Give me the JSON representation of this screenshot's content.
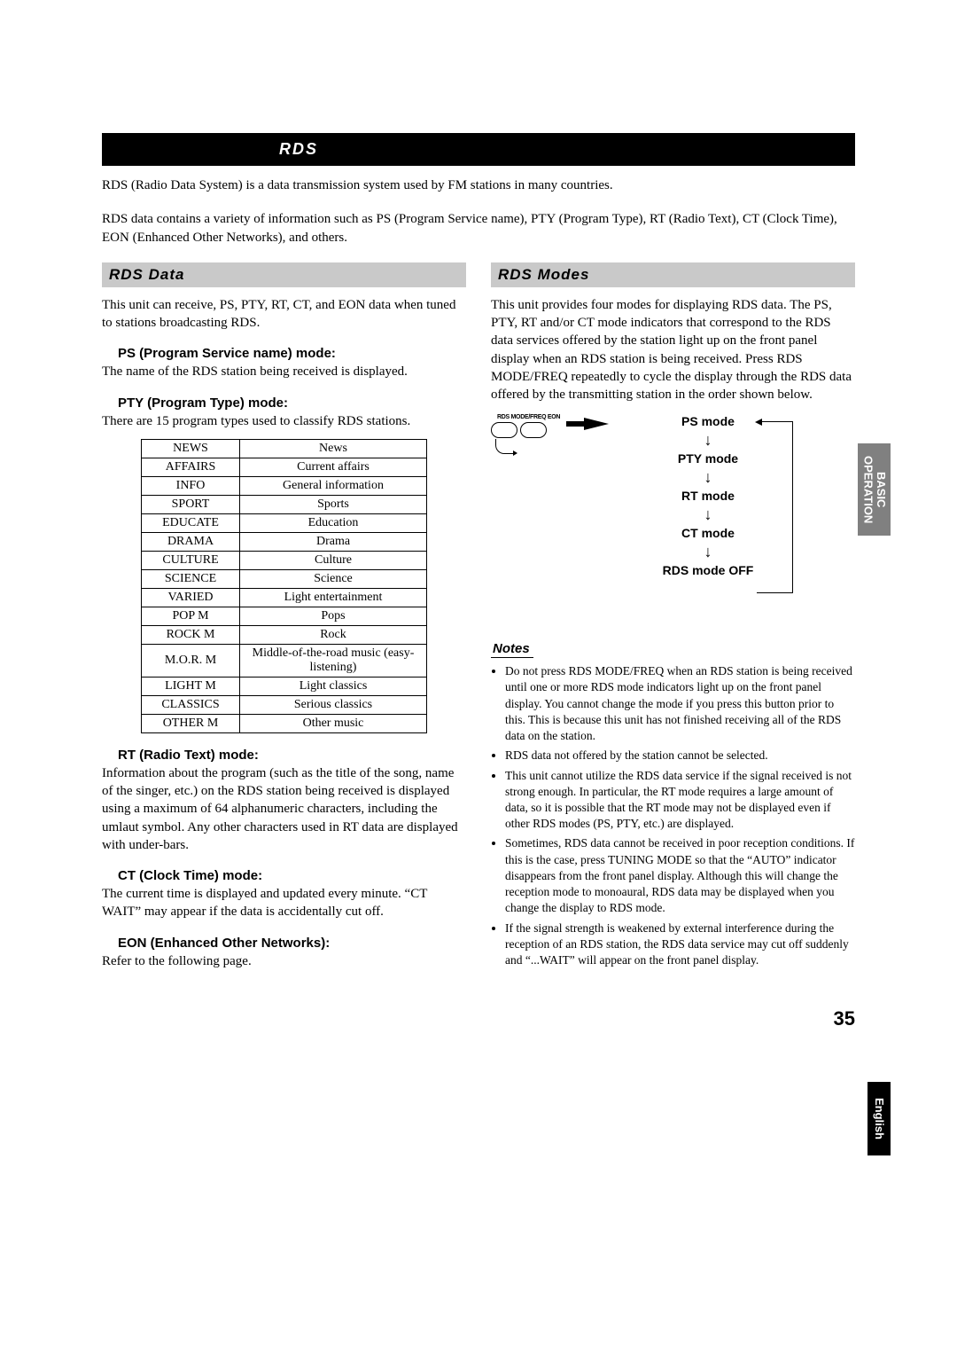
{
  "page_number": "35",
  "side_tab_operation": "BASIC\nOPERATION",
  "side_tab_language": "English",
  "blackbar_title": "RDS",
  "intro_p1": "RDS (Radio Data System) is a data transmission system used by FM stations in many countries.",
  "intro_p2": "RDS data contains a variety of information such as PS (Program Service name), PTY (Program Type), RT (Radio Text), CT (Clock Time), EON (Enhanced Other Networks), and others.",
  "left": {
    "header": "RDS Data",
    "intro": "This unit can receive, PS, PTY, RT, CT, and EON data when tuned to stations broadcasting RDS.",
    "ps_head": "PS (Program Service name) mode:",
    "ps_body": "The name of the RDS station being received is displayed.",
    "pty_head": "PTY (Program Type) mode:",
    "pty_body": "There are 15 program types used to classify RDS stations.",
    "pty_table": [
      [
        "NEWS",
        "News"
      ],
      [
        "AFFAIRS",
        "Current affairs"
      ],
      [
        "INFO",
        "General information"
      ],
      [
        "SPORT",
        "Sports"
      ],
      [
        "EDUCATE",
        "Education"
      ],
      [
        "DRAMA",
        "Drama"
      ],
      [
        "CULTURE",
        "Culture"
      ],
      [
        "SCIENCE",
        "Science"
      ],
      [
        "VARIED",
        "Light entertainment"
      ],
      [
        "POP M",
        "Pops"
      ],
      [
        "ROCK M",
        "Rock"
      ],
      [
        "M.O.R. M",
        "Middle-of-the-road music (easy-listening)"
      ],
      [
        "LIGHT M",
        "Light classics"
      ],
      [
        "CLASSICS",
        "Serious classics"
      ],
      [
        "OTHER M",
        "Other music"
      ]
    ],
    "rt_head": "RT (Radio Text) mode:",
    "rt_body": "Information about the program (such as the title of the song, name of the singer, etc.) on the RDS station being received is displayed using a maximum of 64 alphanumeric characters, including the umlaut symbol. Any other characters used in RT data are displayed with under-bars.",
    "ct_head": "CT (Clock Time) mode:",
    "ct_body": "The current time is displayed and updated every minute. “CT WAIT” may appear if the data is accidentally cut off.",
    "eon_head": "EON (Enhanced Other Networks):",
    "eon_body": "Refer to the following page."
  },
  "right": {
    "header": "RDS Modes",
    "intro": "This unit provides four modes for displaying RDS data. The PS, PTY, RT and/or CT mode indicators that correspond to the RDS data services offered by the station light up on the front panel display when an RDS station is being received. Press RDS MODE/FREQ repeatedly to cycle the display through the RDS data offered by the transmitting station in the order shown below.",
    "diagram": {
      "button_label": "RDS MODE/FREQ    EON",
      "modes": [
        "PS mode",
        "PTY mode",
        "RT mode",
        "CT mode",
        "RDS mode OFF"
      ]
    },
    "notes_label": "Notes",
    "notes": [
      "Do not press RDS MODE/FREQ when an RDS station is being received until one or more RDS mode indicators light up on the front panel display. You cannot change the mode if you press this button prior to this. This is because this unit has not finished receiving all of the RDS data on the station.",
      "RDS data not offered by the station cannot be selected.",
      "This unit cannot utilize the RDS data service if the signal received is not strong enough. In particular, the RT mode requires a large amount of data, so it is possible that the RT mode may not be displayed even if other RDS modes (PS, PTY, etc.) are displayed.",
      "Sometimes, RDS data cannot be received in poor reception conditions. If this is the case, press TUNING MODE so that the “AUTO” indicator disappears from the front panel display. Although this will change the reception mode to monoaural, RDS data may be displayed when you change the display to RDS mode.",
      "If the signal strength is weakened by external interference during the reception of an RDS station, the RDS data service may cut off suddenly and “...WAIT” will appear on the front panel display."
    ]
  }
}
